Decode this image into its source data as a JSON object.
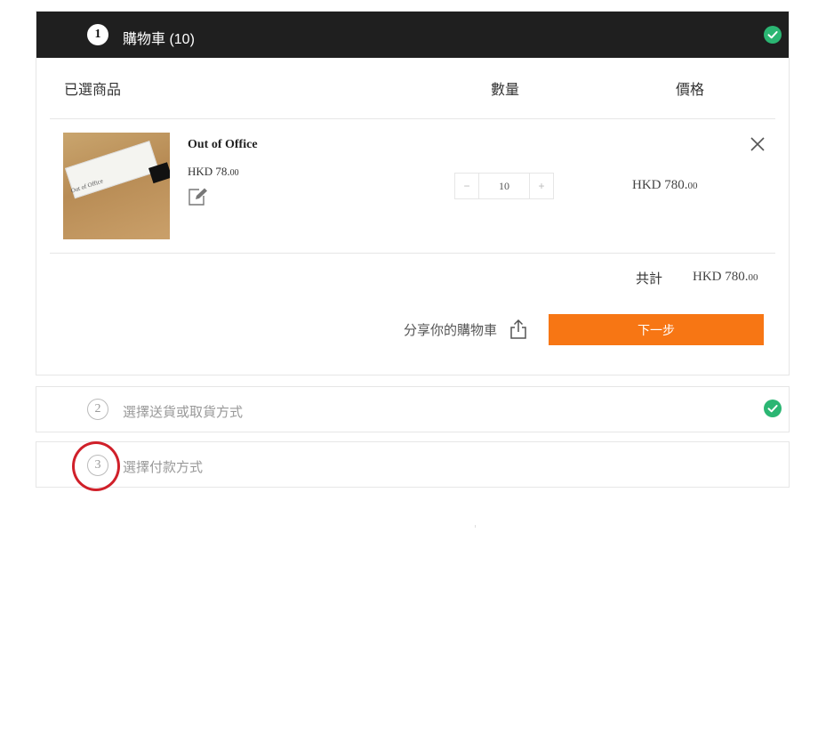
{
  "steps": [
    {
      "number": "1",
      "title": "購物車 (10)"
    },
    {
      "number": "2",
      "title": "選擇送貨或取貨方式"
    },
    {
      "number": "3",
      "title": "選擇付款方式"
    }
  ],
  "cart": {
    "columns": {
      "product": "已選商品",
      "quantity": "數量",
      "price": "價格"
    },
    "item": {
      "name": "Out of Office",
      "unit_price": "HKD 78.",
      "unit_price_cents": "00",
      "quantity": "10",
      "line_total": "HKD 780.",
      "line_total_cents": "00"
    },
    "total_label": "共計",
    "total_value": "HKD 780.",
    "total_cents": "00",
    "share_label": "分享你的購物車",
    "next_label": "下一步"
  },
  "icons": {
    "step_done": "check-circle-icon",
    "edit": "edit-note-icon",
    "remove": "close-icon",
    "share": "share-icon"
  },
  "colors": {
    "header_bg": "#1f1f1f",
    "accent": "#f77614",
    "check": "#2bb673",
    "highlight": "#d0202a"
  }
}
